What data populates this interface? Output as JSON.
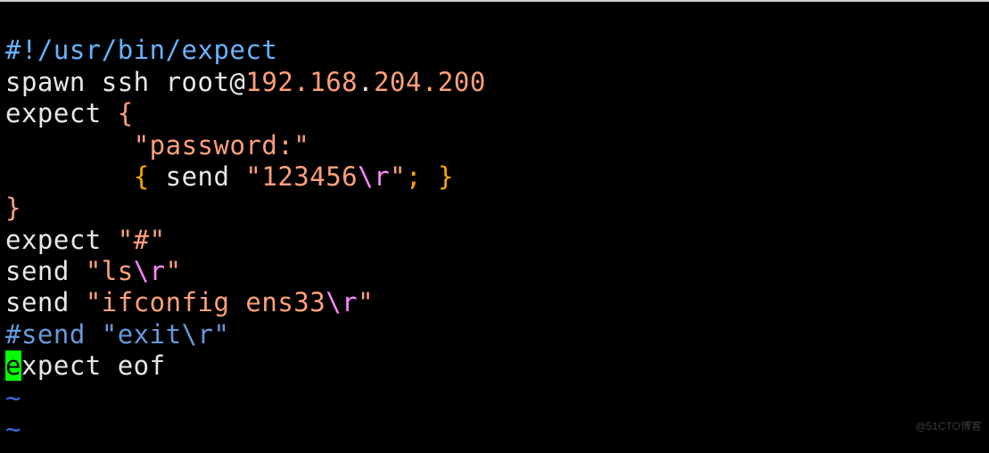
{
  "code": {
    "l1": {
      "a": "#!/usr/bin/expect"
    },
    "l2": {
      "a": "spawn ssh root@",
      "b": "192.168",
      "c": ".",
      "d": "204.200"
    },
    "l3": {
      "a": "expect ",
      "b": "{"
    },
    "l4": {
      "a": "        ",
      "b": "\"password:\""
    },
    "l5": {
      "a": "        ",
      "b": "{",
      "c": " send ",
      "d": "\"123456",
      "e": "\\r",
      "f": "\"",
      "g": ";",
      "h": " ",
      "i": "}"
    },
    "l6": {
      "a": "}"
    },
    "l7": {
      "a": "expect ",
      "b": "\"#\""
    },
    "l8": {
      "a": "send ",
      "b": "\"ls",
      "c": "\\r",
      "d": "\""
    },
    "l9": {
      "a": "send ",
      "b": "\"ifconfig ens33",
      "c": "\\r",
      "d": "\""
    },
    "l10": {
      "a": "#send \"exit\\r\""
    },
    "l11": {
      "a": "e",
      "b": "xpect eof"
    },
    "t1": {
      "a": "~"
    },
    "t2": {
      "a": "~"
    }
  },
  "watermark": "@51CTO博客"
}
